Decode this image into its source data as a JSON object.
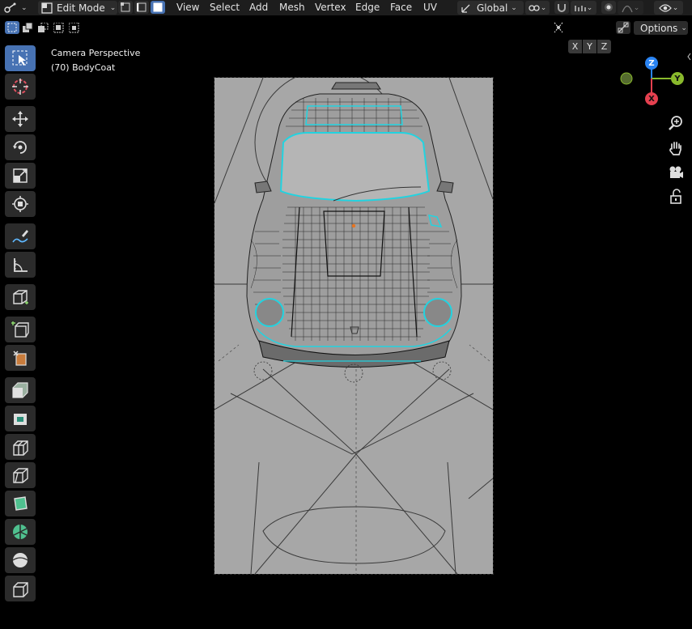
{
  "header": {
    "mode_label": "Edit Mode",
    "menus": [
      "View",
      "Select",
      "Add",
      "Mesh",
      "Vertex",
      "Edge",
      "Face",
      "UV"
    ],
    "orientation_label": "Global"
  },
  "axis_toggles": [
    "X",
    "Y",
    "Z"
  ],
  "options_label": "Options",
  "viewport": {
    "view_name": "Camera Perspective",
    "object_label": "(70) BodyCoat"
  },
  "gizmo": {
    "z": "Z",
    "y": "Y",
    "x": "X"
  },
  "colors": {
    "accent": "#4772b3",
    "seam": "#22d3e0",
    "gizmo_x": "#e5404f",
    "gizmo_y": "#89b92c",
    "gizmo_z": "#2a84f3"
  },
  "tools": [
    "select-box-icon",
    "cursor-icon",
    "move-icon",
    "rotate-icon",
    "scale-icon",
    "transform-icon",
    "annotate-icon",
    "measure-icon",
    "add-cube-icon",
    "extrude-region-icon",
    "extrude-manifold-icon",
    "inset-faces-icon",
    "bevel-icon",
    "loop-cut-icon",
    "knife-icon",
    "poly-build-icon",
    "spin-icon",
    "smooth-icon",
    "edge-slide-icon",
    "shrink-fatten-icon"
  ]
}
